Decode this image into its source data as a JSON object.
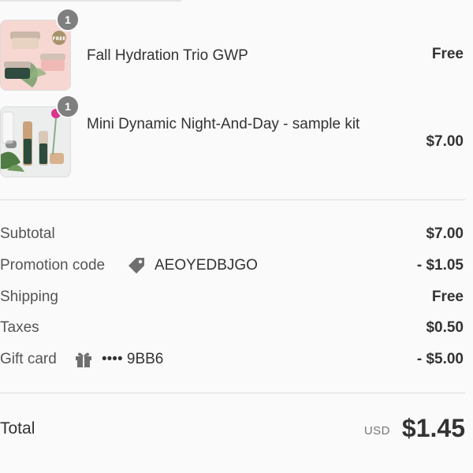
{
  "items": [
    {
      "name": "Fall Hydration Trio GWP",
      "price": "Free",
      "quantity": "1",
      "image": "skincare-trio-jars",
      "image_tag": "FREE"
    },
    {
      "name": "Mini Dynamic Night-And-Day - sample kit",
      "price": "$7.00",
      "quantity": "1",
      "image": "sample-kit-bottles"
    }
  ],
  "summary": {
    "subtotal": {
      "label": "Subtotal",
      "value": "$7.00"
    },
    "promotion": {
      "label": "Promotion code",
      "code": "AEOYEDBJGO",
      "value": "- $1.05",
      "icon": "tag-icon"
    },
    "shipping": {
      "label": "Shipping",
      "value": "Free"
    },
    "taxes": {
      "label": "Taxes",
      "value": "$0.50"
    },
    "gift_card": {
      "label": "Gift card",
      "masked": "•••• 9BB6",
      "value": "- $5.00",
      "icon": "gift-icon"
    }
  },
  "total": {
    "label": "Total",
    "currency": "USD",
    "value": "$1.45"
  },
  "colors": {
    "background": "#fafafa",
    "text": "#333333",
    "badge": "#7f7f7f",
    "divider": "#dedede"
  }
}
